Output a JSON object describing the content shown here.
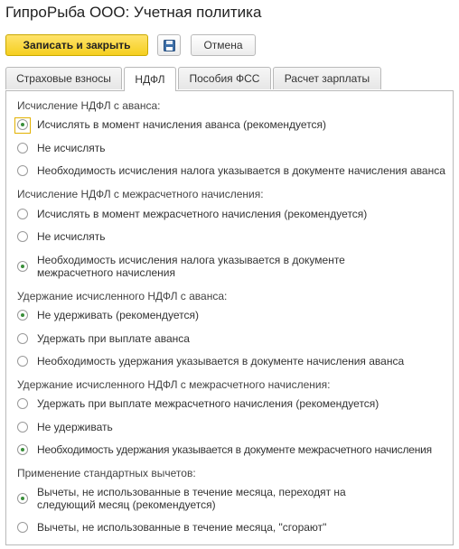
{
  "window": {
    "title": "ГипроРыба ООО: Учетная политика"
  },
  "toolbar": {
    "save_close_label": "Записать и закрыть",
    "save_icon": "floppy-disk-icon",
    "cancel_label": "Отмена"
  },
  "tabs": [
    {
      "label": "Страховые взносы",
      "active": false
    },
    {
      "label": "НДФЛ",
      "active": true
    },
    {
      "label": "Пособия ФСС",
      "active": false
    },
    {
      "label": "Расчет зарплаты",
      "active": false
    }
  ],
  "sections": [
    {
      "label": "Исчисление НДФЛ с аванса:",
      "options": [
        {
          "label": "Исчислять в момент начисления аванса (рекомендуется)",
          "checked": true
        },
        {
          "label": "Не исчислять",
          "checked": false
        },
        {
          "label": "Необходимость исчисления налога указывается в документе начисления аванса",
          "checked": false
        }
      ]
    },
    {
      "label": "Исчисление НДФЛ с межрасчетного начисления:",
      "options": [
        {
          "label": "Исчислять в момент межрасчетного начисления (рекомендуется)",
          "checked": false
        },
        {
          "label": "Не исчислять",
          "checked": false
        },
        {
          "label": "Необходимость исчисления налога указывается в документе межрасчетного начисления",
          "checked": true
        }
      ]
    },
    {
      "label": "Удержание исчисленного НДФЛ с аванса:",
      "options": [
        {
          "label": "Не удерживать (рекомендуется)",
          "checked": true
        },
        {
          "label": "Удержать при выплате аванса",
          "checked": false
        },
        {
          "label": "Необходимость удержания указывается в документе начисления аванса",
          "checked": false
        }
      ]
    },
    {
      "label": "Удержание исчисленного НДФЛ с межрасчетного начисления:",
      "options": [
        {
          "label": "Удержать при выплате межрасчетного начисления (рекомендуется)",
          "checked": false
        },
        {
          "label": "Не удерживать",
          "checked": false
        },
        {
          "label": "Необходимость удержания указывается в документе межрасчетного начисления",
          "checked": true
        }
      ]
    },
    {
      "label": "Применение стандартных вычетов:",
      "options": [
        {
          "label": "Вычеты, не использованные в течение месяца, переходят на следующий месяц (рекомендуется)",
          "checked": true
        },
        {
          "label": "Вычеты, не использованные в течение месяца, \"сгорают\"",
          "checked": false
        }
      ]
    }
  ]
}
